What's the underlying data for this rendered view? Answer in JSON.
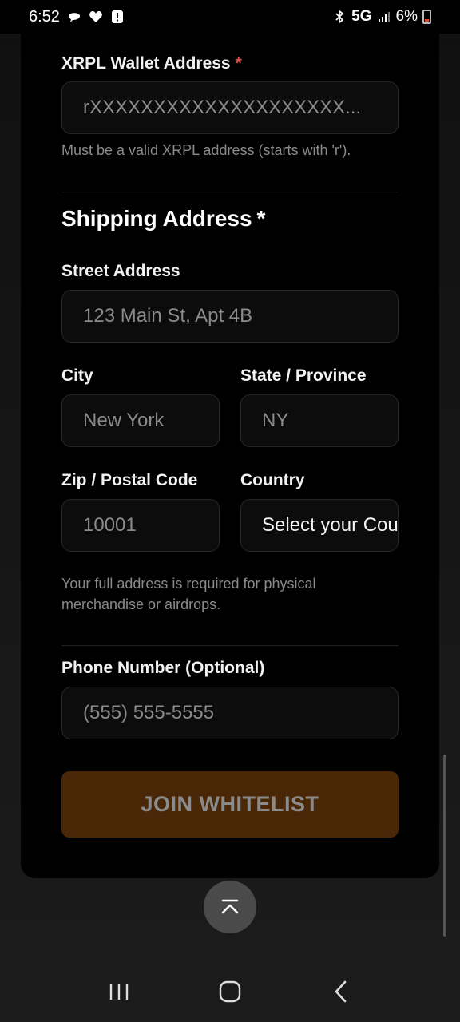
{
  "status_bar": {
    "time": "6:52",
    "network": "5G",
    "battery": "6%"
  },
  "wallet": {
    "label": "XRPL Wallet Address",
    "required_mark": "*",
    "placeholder": "rXXXXXXXXXXXXXXXXXXXX...",
    "hint": "Must be a valid XRPL address (starts with 'r')."
  },
  "shipping": {
    "title": "Shipping Address",
    "required_mark": "*",
    "street_label": "Street Address",
    "street_placeholder": "123 Main St, Apt 4B",
    "city_label": "City",
    "city_placeholder": "New York",
    "state_label": "State / Province",
    "state_placeholder": "NY",
    "zip_label": "Zip / Postal Code",
    "zip_placeholder": "10001",
    "country_label": "Country",
    "country_value": "Select your Country",
    "hint": "Your full address is required for physical merchandise or airdrops."
  },
  "phone": {
    "label": "Phone Number (Optional)",
    "placeholder": "(555) 555-5555"
  },
  "submit": {
    "label": "JOIN WHITELIST"
  }
}
